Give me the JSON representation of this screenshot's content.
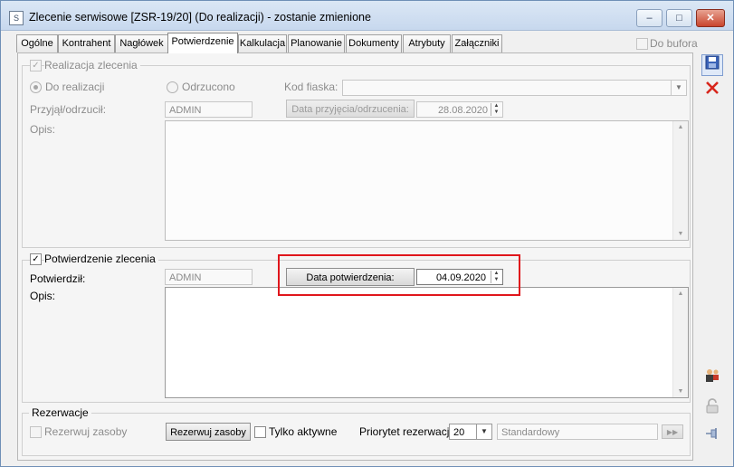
{
  "window": {
    "title": "Zlecenie serwisowe [ZSR-19/20] (Do realizacji) - zostanie zmienione",
    "minimize": "–",
    "maximize": "□",
    "close": "✕"
  },
  "tabs": [
    "Ogólne",
    "Kontrahent",
    "Nagłówek",
    "Potwierdzenie",
    "Kalkulacja",
    "Planowanie",
    "Dokumenty",
    "Atrybuty",
    "Załączniki"
  ],
  "active_tab": "Potwierdzenie",
  "do_bufora": "Do bufora",
  "realizacja": {
    "group_label": "Realizacja zlecenia",
    "radio_do_realizacji": "Do realizacji",
    "radio_odrzucono": "Odrzucono",
    "kod_fiaska_label": "Kod fiaska:",
    "przyjal_label": "Przyjął/odrzucił:",
    "przyjal_value": "ADMIN",
    "data_button": "Data przyjęcia/odrzucenia:",
    "data_value": "28.08.2020",
    "opis_label": "Opis:"
  },
  "potwierdzenie": {
    "group_label": "Potwierdzenie zlecenia",
    "potwierdzil_label": "Potwierdził:",
    "potwierdzil_value": "ADMIN",
    "data_button": "Data potwierdzenia:",
    "data_value": "04.09.2020",
    "opis_label": "Opis:"
  },
  "rezerwacje": {
    "group_label": "Rezerwacje",
    "rezerwuj_checkbox": "Rezerwuj zasoby",
    "rezerwuj_button": "Rezerwuj zasoby",
    "tylko_aktywne": "Tylko aktywne",
    "priorytet_label": "Priorytet rezerwacji:",
    "priorytet_value": "20",
    "standard_value": "Standardowy"
  },
  "colors": {
    "highlight": "#e0161c",
    "titlebar": "#c7d8ee"
  }
}
